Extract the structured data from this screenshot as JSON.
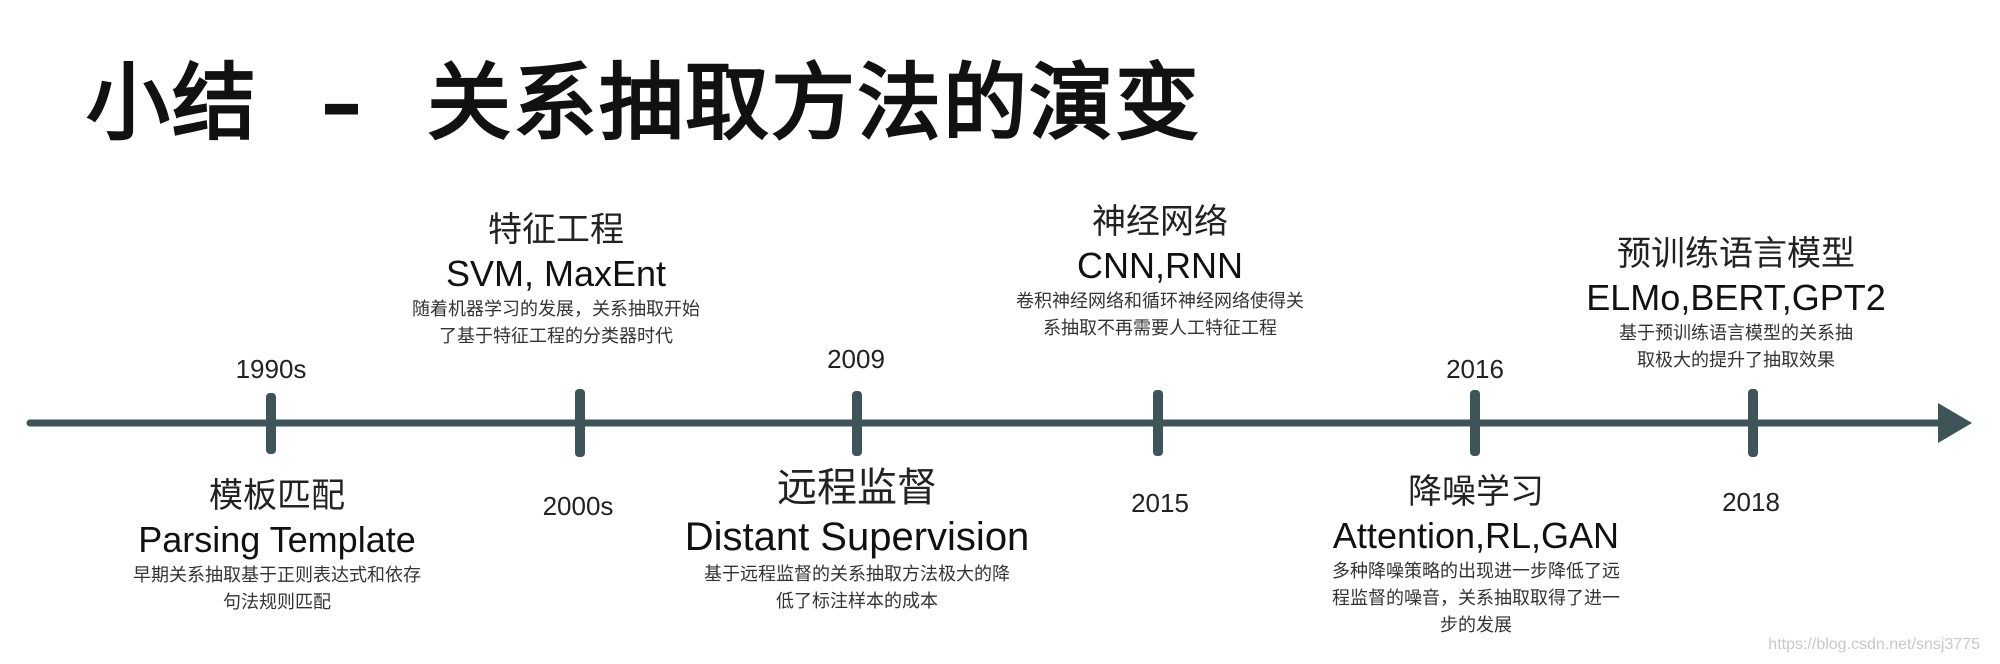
{
  "title": "小结  –  关系抽取方法的演变",
  "timeline": {
    "years": [
      "1990s",
      "2000s",
      "2009",
      "2015",
      "2016",
      "2018"
    ],
    "milestones": [
      {
        "cn": "模板匹配",
        "en": "Parsing Template",
        "desc": [
          "早期关系抽取基于正则表达式和依存",
          "句法规则匹配"
        ]
      },
      {
        "cn": "特征工程",
        "en": "SVM, MaxEnt",
        "desc": [
          "随着机器学习的发展，关系抽取开始",
          "了基于特征工程的分类器时代"
        ]
      },
      {
        "cn": "远程监督",
        "en": "Distant Supervision",
        "desc": [
          "基于远程监督的关系抽取方法极大的降",
          "低了标注样本的成本"
        ]
      },
      {
        "cn": "神经网络",
        "en": "CNN,RNN",
        "desc": [
          "卷积神经网络和循环神经网络使得关",
          "系抽取不再需要人工特征工程"
        ]
      },
      {
        "cn": "降噪学习",
        "en": "Attention,RL,GAN",
        "desc": [
          "多种降噪策略的出现进一步降低了远",
          "程监督的噪音，关系抽取取得了进一",
          "步的发展"
        ]
      },
      {
        "cn": "预训练语言模型",
        "en": "ELMo,BERT,GPT2",
        "desc": [
          "基于预训练语言模型的关系抽",
          "取极大的提升了抽取效果"
        ]
      }
    ]
  },
  "watermark": "https://blog.csdn.net/snsj3775",
  "colors": {
    "axis": "#3e5458",
    "title": "#111111"
  }
}
